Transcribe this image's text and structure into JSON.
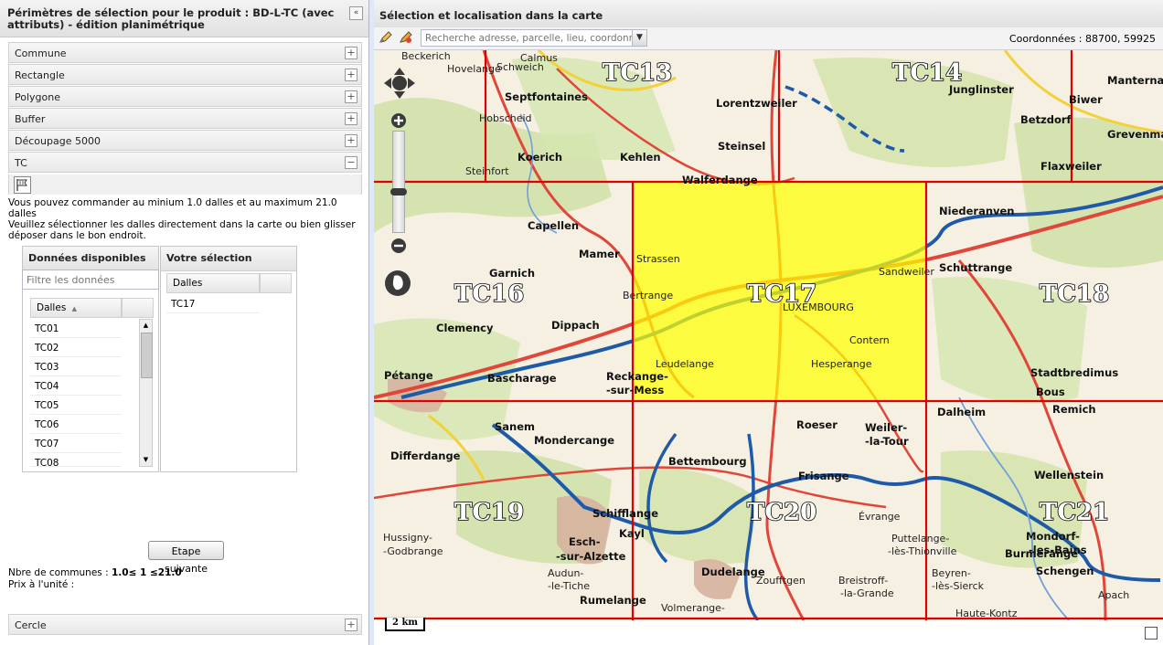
{
  "left": {
    "title": "Périmètres de sélection pour le produit : BD-L-TC (avec attributs) - édition planimétrique",
    "collapse_glyph": "«",
    "accordion": [
      {
        "label": "Commune",
        "glyph": "+"
      },
      {
        "label": "Rectangle",
        "glyph": "+"
      },
      {
        "label": "Polygone",
        "glyph": "+"
      },
      {
        "label": "Buffer",
        "glyph": "+"
      },
      {
        "label": "Découpage 5000",
        "glyph": "+"
      },
      {
        "label": "TC",
        "glyph": "−"
      }
    ],
    "info_line1": "Vous pouvez commander au minium 1.0 dalles et au maximum 21.0 dalles",
    "info_line2": "Veuillez sélectionner les dalles directement dans la carte ou bien glisser déposer dans le bon endroit.",
    "available": {
      "title": "Données disponibles",
      "filter_placeholder": "Filtre les données",
      "column": "Dalles",
      "sort_glyph": "▲",
      "rows": [
        "TC01",
        "TC02",
        "TC03",
        "TC04",
        "TC05",
        "TC06",
        "TC07",
        "TC08"
      ]
    },
    "selection": {
      "title": "Votre sélection",
      "column": "Dalles",
      "rows": [
        "TC17"
      ]
    },
    "next_button": "Etape suivante",
    "count_label": "Nbre de communes :",
    "count_value": "1.0≤ 1 ≤21.0",
    "unit_price_label": "Prix à l'unité :",
    "cercle": {
      "label": "Cercle",
      "glyph": "+"
    }
  },
  "right": {
    "title": "Sélection et localisation dans la carte",
    "search_placeholder": "Recherche adresse, parcelle, lieu, coordonnÃ©",
    "coords": "Coordonnées : 88700, 59925",
    "scale": "2 km",
    "tiles": {
      "TC13": "TC13",
      "TC14": "TC14",
      "TC16": "TC16",
      "TC17": "TC17",
      "TC18": "TC18",
      "TC19": "TC19",
      "TC20": "TC20",
      "TC21": "TC21"
    },
    "places": {
      "beckerich": "Beckerich",
      "calmus": "Calmus",
      "schweich": "Schweich",
      "hovelange": "Hovelange",
      "septfontaines": "Septfontaines",
      "hobscheid": "Hobscheid",
      "koerich": "Koerich",
      "kehlen": "Kehlen",
      "steinfort": "Steinfort",
      "lorentzweiler": "Lorentzweiler",
      "steinsel": "Steinsel",
      "walferdange": "Walferdange",
      "junglinster": "Junglinster",
      "manternach": "Manternach",
      "betzdorf": "Betzdorf",
      "biwer": "Biwer",
      "grevenmacher": "Grevenmac",
      "flaxweiler": "Flaxweiler",
      "capellen": "Capellen",
      "mamer": "Mamer",
      "garnich": "Garnich",
      "strassen": "Strassen",
      "bertrange": "Bertrange",
      "luxembourg": "LUXEMBOURG",
      "sandweiler": "Sandweiler",
      "niederanven": "Niederanven",
      "schuttrange": "Schuttrange",
      "clemency": "Clemency",
      "dippach": "Dippach",
      "petange": "Pétange",
      "bascharage": "Bascharage",
      "reckange": "Reckange-",
      "surmess": "-sur-Mess",
      "leudelange": "Leudelange",
      "hesperange": "Hesperange",
      "contern": "Contern",
      "stadtbredimus": "Stadtbredimus",
      "bous": "Bous",
      "remich": "Remich",
      "dalheim": "Dalheim",
      "weiler": "Weiler-",
      "latour": "-la-Tour",
      "roeser": "Roeser",
      "sanem": "Sanem",
      "mondercange": "Mondercange",
      "differdange": "Differdange",
      "schifflange": "Schifflange",
      "esch": "Esch-",
      "suralzette": "-sur-Alzette",
      "kayl": "Kayl",
      "bettembourg": "Bettembourg",
      "frisange": "Frisange",
      "dudelange": "Dudelange",
      "rumelange": "Rumelange",
      "wellenstein": "Wellenstein",
      "mondorf": "Mondorf-",
      "lesbains": "-les-Bains",
      "burmerange": "Burmerange",
      "schengen": "Schengen",
      "evrange": "Évrange",
      "zoufftgen": "Zoufftgen",
      "hussigny": "Hussigny-",
      "godbrange": "-Godbrange",
      "audun": "Audun-",
      "letiche": "-le-Tiche",
      "volmerange": "Volmerange-",
      "breistroff": "Breistroff-",
      "lagrande": "-la-Grande",
      "puttelange": "Puttelange-",
      "thionville": "-lès-Thionville",
      "beyren": "Beyren-",
      "sierck": "-lès-Sierck",
      "apach": "Apach",
      "hautekontz": "Haute-Kontz"
    }
  },
  "colors": {
    "grid_red": "#e00000",
    "selection_fill": "#ffff00",
    "road_red": "#e0473a",
    "road_blue": "#1f5aa8",
    "forest": "#c8dba0",
    "map_bg": "#f6f0e2"
  },
  "icons": {
    "pan": "pan-control-icon",
    "zoom_in": "zoom-in-icon",
    "zoom_out": "zoom-out-icon",
    "flag": "flag-select-icon",
    "pencil": "draw-pencil-icon",
    "pencil2": "draw-erase-icon"
  }
}
